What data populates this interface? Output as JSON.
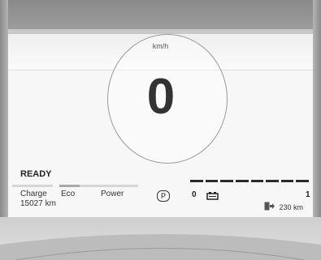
{
  "dashboard": {
    "speed_unit": "km/h",
    "speed_value": "0",
    "status_text": "READY",
    "power_meter_labels": {
      "charge": "Charge",
      "eco": "Eco",
      "power": "Power"
    },
    "odometer": "15027 km",
    "gear": "P",
    "battery_scale_min": "0",
    "battery_scale_max": "1",
    "battery_level": 1.0,
    "range_text": "230 km"
  }
}
